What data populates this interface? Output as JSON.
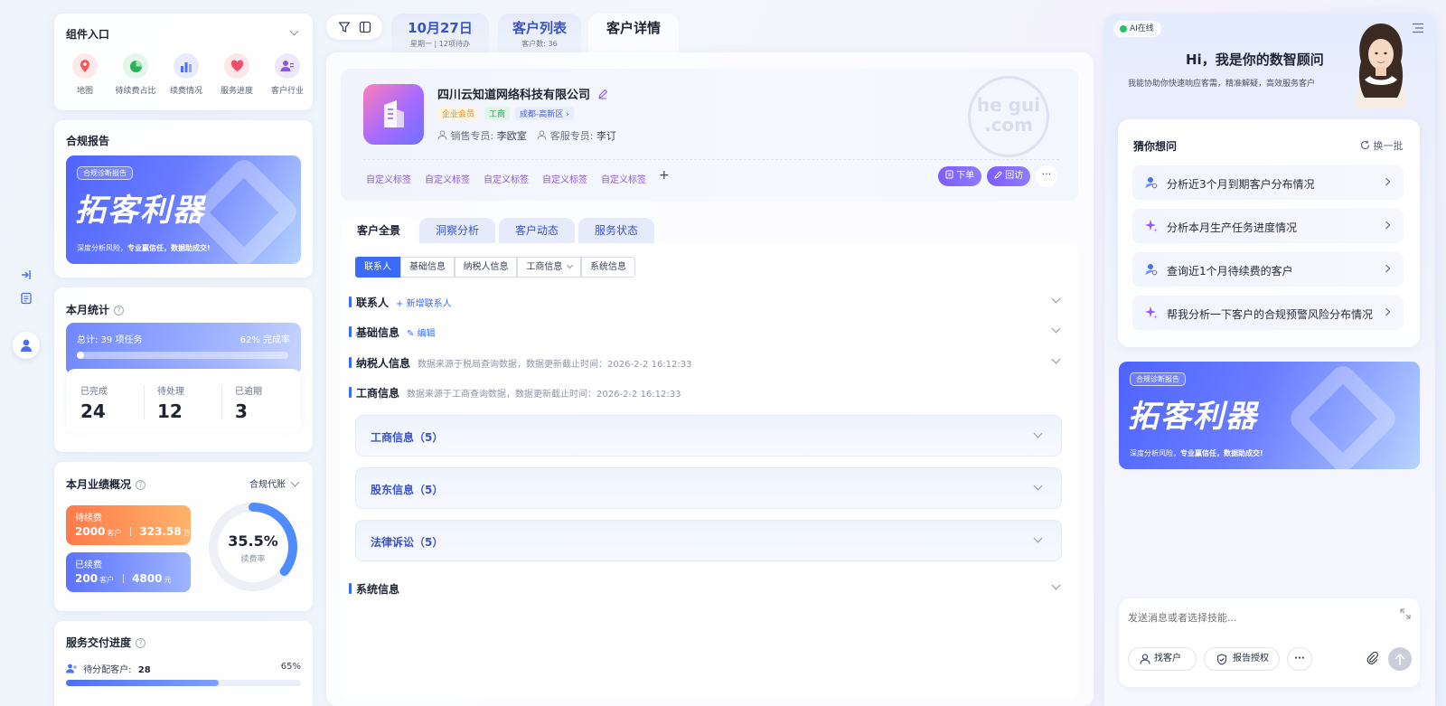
{
  "left": {
    "components": {
      "title": "组件入口",
      "items": [
        {
          "label": "地图",
          "icon": "map-pin-icon",
          "color": "#ef5a5a",
          "bg": "#fde9ea"
        },
        {
          "label": "待续费占比",
          "icon": "pie-chart-icon",
          "color": "#26b35a",
          "bg": "#e4f6ea"
        },
        {
          "label": "续费情况",
          "icon": "bar-chart-icon",
          "color": "#4f6ef7",
          "bg": "#e6ebfd"
        },
        {
          "label": "服务进度",
          "icon": "heart-icon",
          "color": "#ef4d6a",
          "bg": "#fde6ea"
        },
        {
          "label": "客户行业",
          "icon": "people-icon",
          "color": "#8a5bd8",
          "bg": "#efe8fb"
        }
      ]
    },
    "report": {
      "title": "合规报告",
      "tag": "合规诊断报告",
      "headline": "拓客利器",
      "desc_plain": "深度分析风险，",
      "desc_bold": "专业赢信任，数据助成交!"
    },
    "monthly": {
      "title": "本月统计",
      "total": "总计: 39 项任务",
      "rate": "62% 完成率",
      "progress": 0.62,
      "stats": [
        {
          "label": "已完成",
          "value": "24"
        },
        {
          "label": "待处理",
          "value": "12"
        },
        {
          "label": "已逾期",
          "value": "3"
        }
      ]
    },
    "performance": {
      "title": "本月业绩概况",
      "filter": "合规代账",
      "pending": {
        "label": "待续费",
        "count": "2000",
        "count_unit": "客户",
        "amount": "323.58",
        "amount_unit": "万元"
      },
      "done": {
        "label": "已续费",
        "count": "200",
        "count_unit": "客户",
        "amount": "4800",
        "amount_unit": "元"
      },
      "ring_value": "35.5%",
      "ring_label": "续费率",
      "ring_fraction": 0.355
    },
    "delivery": {
      "title": "服务交付进度",
      "label": "待分配客户:",
      "count": "28",
      "percent": "65%",
      "progress": 0.65
    }
  },
  "top_tabs": [
    {
      "label": "10月27日",
      "sub": "星期一 | 12项待办"
    },
    {
      "label": "客户列表",
      "sub": "客户数: 36"
    },
    {
      "label": "客户详情",
      "sub": ""
    }
  ],
  "company": {
    "name": "四川云知道网络科技有限公司",
    "tags": [
      "企业会员",
      "工商",
      "成都-高新区 ›"
    ],
    "sales_label": "销售专员:",
    "sales": "李欧室",
    "service_label": "客服专员:",
    "service": "李订",
    "custom_tags": [
      "自定义标签",
      "自定义标签",
      "自定义标签",
      "自定义标签",
      "自定义标签"
    ],
    "add": "+",
    "order_btn": "下单",
    "visit_btn": "回访",
    "more": "···",
    "watermark": "he gui .com"
  },
  "sub_tabs": [
    "客户全景",
    "洞察分析",
    "客户动态",
    "服务状态"
  ],
  "segments": [
    "联系人",
    "基础信息",
    "纳税人信息",
    "工商信息",
    "系统信息"
  ],
  "sections": {
    "contact": {
      "title": "联系人",
      "link": "+ 新增联系人"
    },
    "basic": {
      "title": "基础信息",
      "link": "✎ 编辑"
    },
    "tax": {
      "title": "纳税人信息",
      "note": "数据来源于税局查询数据，数据更新截止时间：2026-2-2 16:12:33"
    },
    "biz": {
      "title": "工商信息",
      "note": "数据来源于工商查询数据，数据更新截止时间：2026-2-2 16:12:33"
    },
    "system": {
      "title": "系统信息"
    }
  },
  "accordions": [
    "工商信息（5）",
    "股东信息（5）",
    "法律诉讼（5）"
  ],
  "left_rail": {
    "icons": [
      "expand-icon",
      "document-icon",
      "user-icon"
    ]
  },
  "ai": {
    "status": "AI在线",
    "greeting": "Hi，我是你的数智顾问",
    "intro": "我能协助你快速响应客需，精准解疑，高效服务客户",
    "guess_title": "猜你想问",
    "refresh": "换一批",
    "questions": [
      {
        "text": "分析近3个月到期客户分布情况",
        "icon": "user-search-icon"
      },
      {
        "text": "分析本月生产任务进度情况",
        "icon": "sparkle-icon"
      },
      {
        "text": "查询近1个月待续费的客户",
        "icon": "user-search-icon"
      },
      {
        "text": "帮我分析一下客户的合规预警风险分布情况",
        "icon": "sparkle-icon"
      }
    ],
    "banner": {
      "tag": "合规诊断报告",
      "headline": "拓客利器",
      "desc_plain": "深度分析风险，",
      "desc_bold": "专业赢信任，数据助成交!"
    },
    "input_placeholder": "发送消息或者选择技能...",
    "find_customer": "找客户",
    "report_auth": "报告授权",
    "more": "···"
  },
  "colors": {
    "primary": "#3b6bf6",
    "purple": "#8a5bd8",
    "orange": "#ff8a4c"
  }
}
